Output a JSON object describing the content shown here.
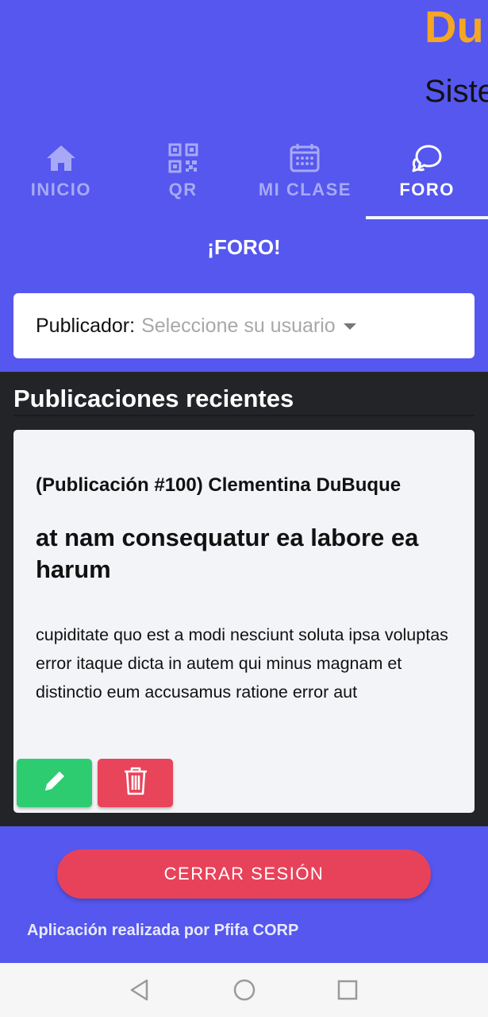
{
  "header": {
    "brand": "Du",
    "subtitle": "Siste"
  },
  "tabs": [
    {
      "label": "INICIO",
      "icon": "home-icon"
    },
    {
      "label": "QR",
      "icon": "qr-code-icon"
    },
    {
      "label": "MI CLASE",
      "icon": "calendar-icon"
    },
    {
      "label": "FORO",
      "icon": "chat-bubbles-icon",
      "active": true
    }
  ],
  "section": {
    "title": "¡FORO!"
  },
  "publisher": {
    "label": "Publicador:",
    "placeholder": "Seleccione su usuario"
  },
  "recent": {
    "title": "Publicaciones recientes"
  },
  "post": {
    "author": "(Publicación #100) Clementina DuBuque",
    "title": "at nam consequatur ea labore ea harum",
    "body": "cupiditate quo est a modi nesciunt soluta ipsa voluptas error itaque dicta in autem qui minus magnam et distinctio eum accusamus ratione error aut",
    "edit_icon": "pencil-icon",
    "delete_icon": "trash-icon"
  },
  "actions": {
    "logout_label": "CERRAR SESIÓN"
  },
  "footer": {
    "text": "Aplicación realizada por Pfifa CORP"
  },
  "colors": {
    "primary": "#5557ee",
    "brand": "#f5a623",
    "edit": "#2ecc71",
    "delete": "#e8445a",
    "dark": "#232427"
  }
}
